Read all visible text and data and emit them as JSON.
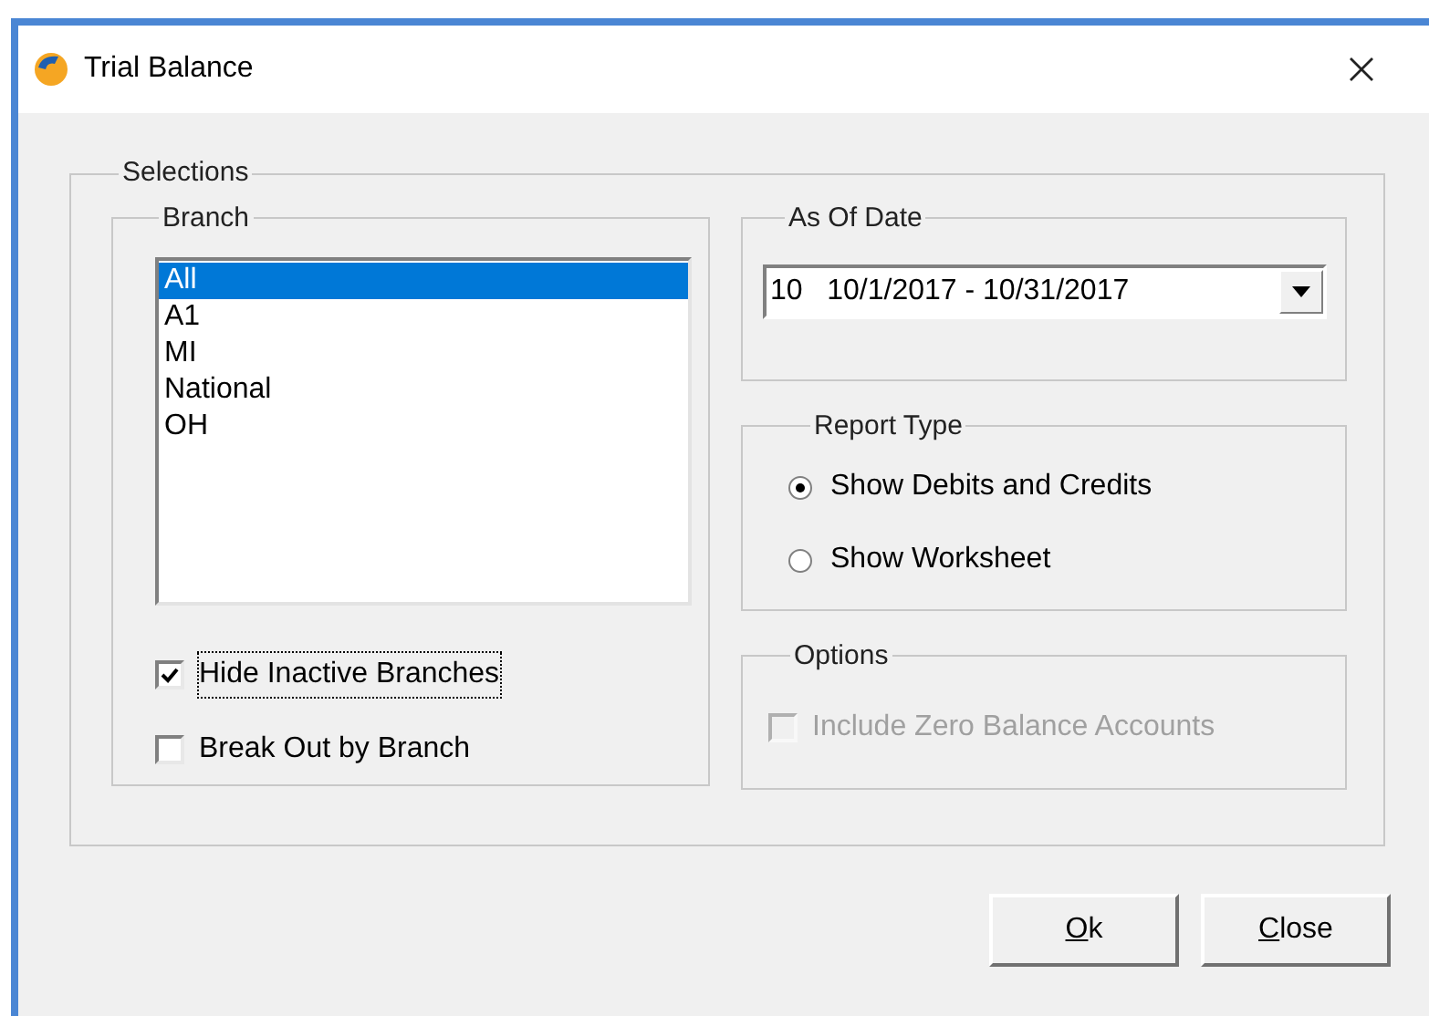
{
  "window": {
    "title": "Trial Balance"
  },
  "selections": {
    "title": "Selections",
    "branch": {
      "title": "Branch",
      "items": [
        {
          "label": "All",
          "selected": true
        },
        {
          "label": "A1",
          "selected": false
        },
        {
          "label": "MI",
          "selected": false
        },
        {
          "label": "National",
          "selected": false
        },
        {
          "label": "OH",
          "selected": false
        }
      ],
      "options": [
        {
          "label": "Hide Inactive Branches",
          "checked": true,
          "focused": true
        },
        {
          "label": "Break Out by Branch",
          "checked": false,
          "focused": false
        }
      ]
    },
    "as_of_date": {
      "title": "As Of Date",
      "value": "10   10/1/2017 - 10/31/2017"
    },
    "report_type": {
      "title": "Report Type",
      "options": [
        {
          "label": "Show Debits and Credits",
          "selected": true
        },
        {
          "label": "Show Worksheet",
          "selected": false
        }
      ]
    },
    "options": {
      "title": "Options",
      "items": [
        {
          "label": "Include Zero Balance Accounts",
          "checked": false,
          "disabled": true
        }
      ]
    }
  },
  "buttons": [
    {
      "label": "Ok",
      "first_letter_underlined": true
    },
    {
      "label": "Close",
      "first_letter_underlined": true
    }
  ]
}
